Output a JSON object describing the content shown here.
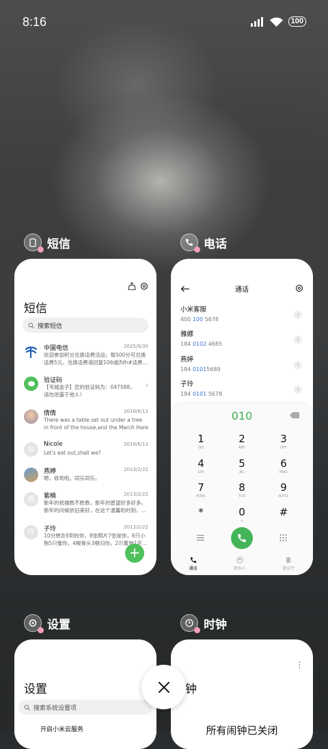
{
  "status": {
    "time": "8:16",
    "battery": "100"
  },
  "apps": [
    {
      "name": "短信",
      "icon": "sms-app-icon"
    },
    {
      "name": "电话",
      "icon": "phone-app-icon"
    },
    {
      "name": "设置",
      "icon": "settings-app-icon"
    },
    {
      "name": "时钟",
      "icon": "clock-app-icon"
    }
  ],
  "sms": {
    "title": "短信",
    "search_placeholder": "搜索短信",
    "messages": [
      {
        "name": "中国电信",
        "date": "2025/9/30",
        "text": "欢迎参加积分兑换话费活动，每500分可兑换话费5元，兑换话费请回复106或jfdh#话费…"
      },
      {
        "name": "验证码",
        "date": "",
        "text": "【韦城盒子】您的验证码为：047588，请勿泄露于他人！"
      },
      {
        "name": "倩倩",
        "date": "2016/6/13",
        "text": "There was a table set out under a tree in front of the house,and the March Hare an…"
      },
      {
        "name": "Nicole",
        "date": "2016/6/13",
        "text": "Let's eat out,shall we?"
      },
      {
        "name": "燕婷",
        "date": "2013/2/22",
        "text": "嗯，收到啦。同乐同乐。"
      },
      {
        "name": "紫楠",
        "date": "2013/2/22",
        "text": "新年的祝福数不胜数，新年的愿望好多好多，新年的问候依旧美好，在这个温馨的时刻，…"
      },
      {
        "name": "子玲",
        "date": "2013/2/22",
        "text": "10分想念9到的你，8张照片7张是你，6只小狗5只像你，4根骨头3根归你，2爪着地1字…"
      }
    ],
    "fab": "+",
    "avatar_letters": {
      "nicole": "N",
      "zinan": "楠",
      "ziling": "玲"
    }
  },
  "phone": {
    "title": "通话",
    "contacts": [
      {
        "name": "小米客服",
        "pre": "400 ",
        "hl": "100",
        "post": " 5678"
      },
      {
        "name": "雅娜",
        "pre": "184 ",
        "hl": "0102",
        "post": " 4685"
      },
      {
        "name": "燕婷",
        "pre": "184 ",
        "hl": "0101",
        "post": "5689"
      },
      {
        "name": "子玲",
        "pre": "184 ",
        "hl": "0101",
        "post": " 5678"
      }
    ],
    "dial_value": "010",
    "keys": [
      {
        "d": "1",
        "l": "QΩ"
      },
      {
        "d": "2",
        "l": "ABC"
      },
      {
        "d": "3",
        "l": "DEF"
      },
      {
        "d": "4",
        "l": "GHI"
      },
      {
        "d": "5",
        "l": "JKL"
      },
      {
        "d": "6",
        "l": "MNO"
      },
      {
        "d": "7",
        "l": "PQRS"
      },
      {
        "d": "8",
        "l": "TUV"
      },
      {
        "d": "9",
        "l": "WXYZ"
      },
      {
        "d": "*",
        "l": ","
      },
      {
        "d": "0",
        "l": "+"
      },
      {
        "d": "#",
        "l": ""
      }
    ],
    "tabs": [
      "通话",
      "联系人",
      "营业厅"
    ]
  },
  "settings": {
    "title": "设置",
    "search_placeholder": "搜索系统设置项",
    "partial_item": "开启小米云服务"
  },
  "clock": {
    "title_partial": "闹钟",
    "empty_text": "所有闹钟已关闭"
  }
}
